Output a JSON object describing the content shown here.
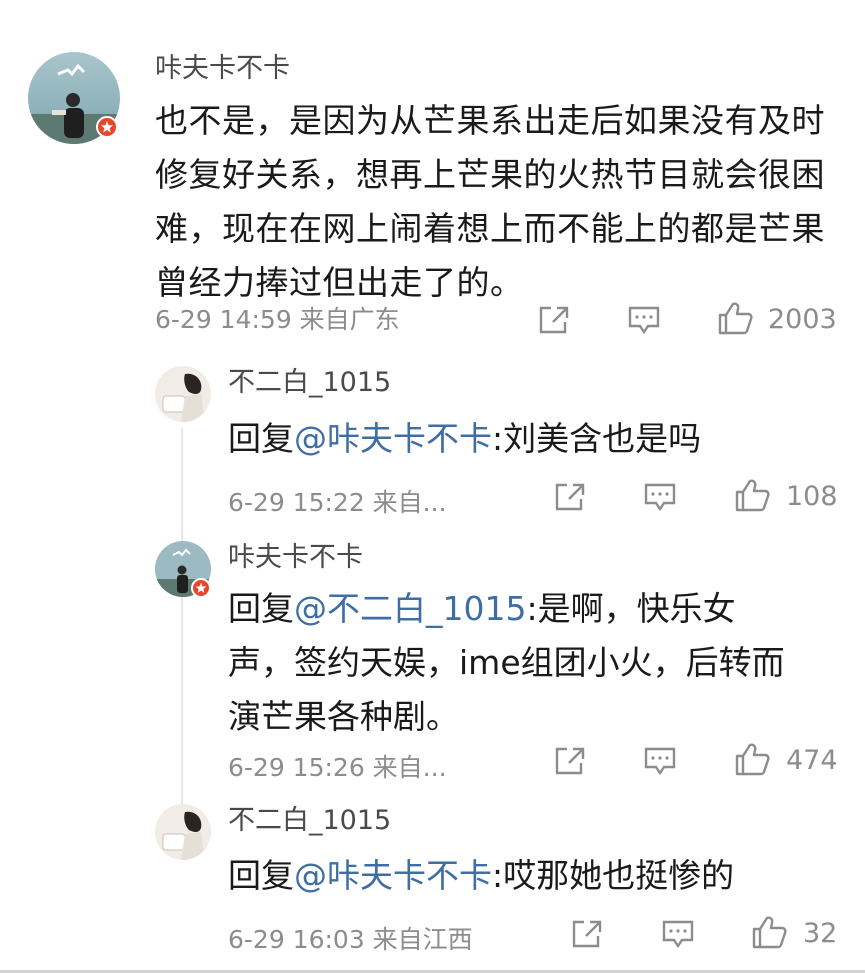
{
  "main_comment": {
    "username": "咔夫卡不卡",
    "text": "也不是，是因为从芒果系出走后如果没有及时修复好关系，想再上芒果的火热节目就会很困难，现在在网上闹着想上而不能上的都是芒果曾经力捧过但出走了的。",
    "time_location": "6-29 14:59 来自广东",
    "likes": "2003"
  },
  "replies": [
    {
      "username": "不二白_1015",
      "prefix": "回复",
      "mention": "@咔夫卡不卡",
      "body": ":刘美含也是吗",
      "time_location": "6-29 15:22 来自...",
      "likes": "108"
    },
    {
      "username": "咔夫卡不卡",
      "prefix": "回复",
      "mention": "@不二白_1015",
      "body": ":是啊，快乐女声，签约天娱，ime组团小火，后转而演芒果各种剧。",
      "time_location": "6-29 15:26 来自...",
      "likes": "474"
    },
    {
      "username": "不二白_1015",
      "prefix": "回复",
      "mention": "@咔夫卡不卡",
      "body": ":哎那她也挺惨的",
      "time_location": "6-29 16:03 来自江西",
      "likes": "32"
    }
  ],
  "colors": {
    "mention": "#3f6ea5",
    "meta": "#8c8c8c",
    "badge": "#e8462b"
  },
  "icons": [
    "share-icon",
    "comment-icon",
    "like-icon",
    "verified-badge-icon"
  ]
}
